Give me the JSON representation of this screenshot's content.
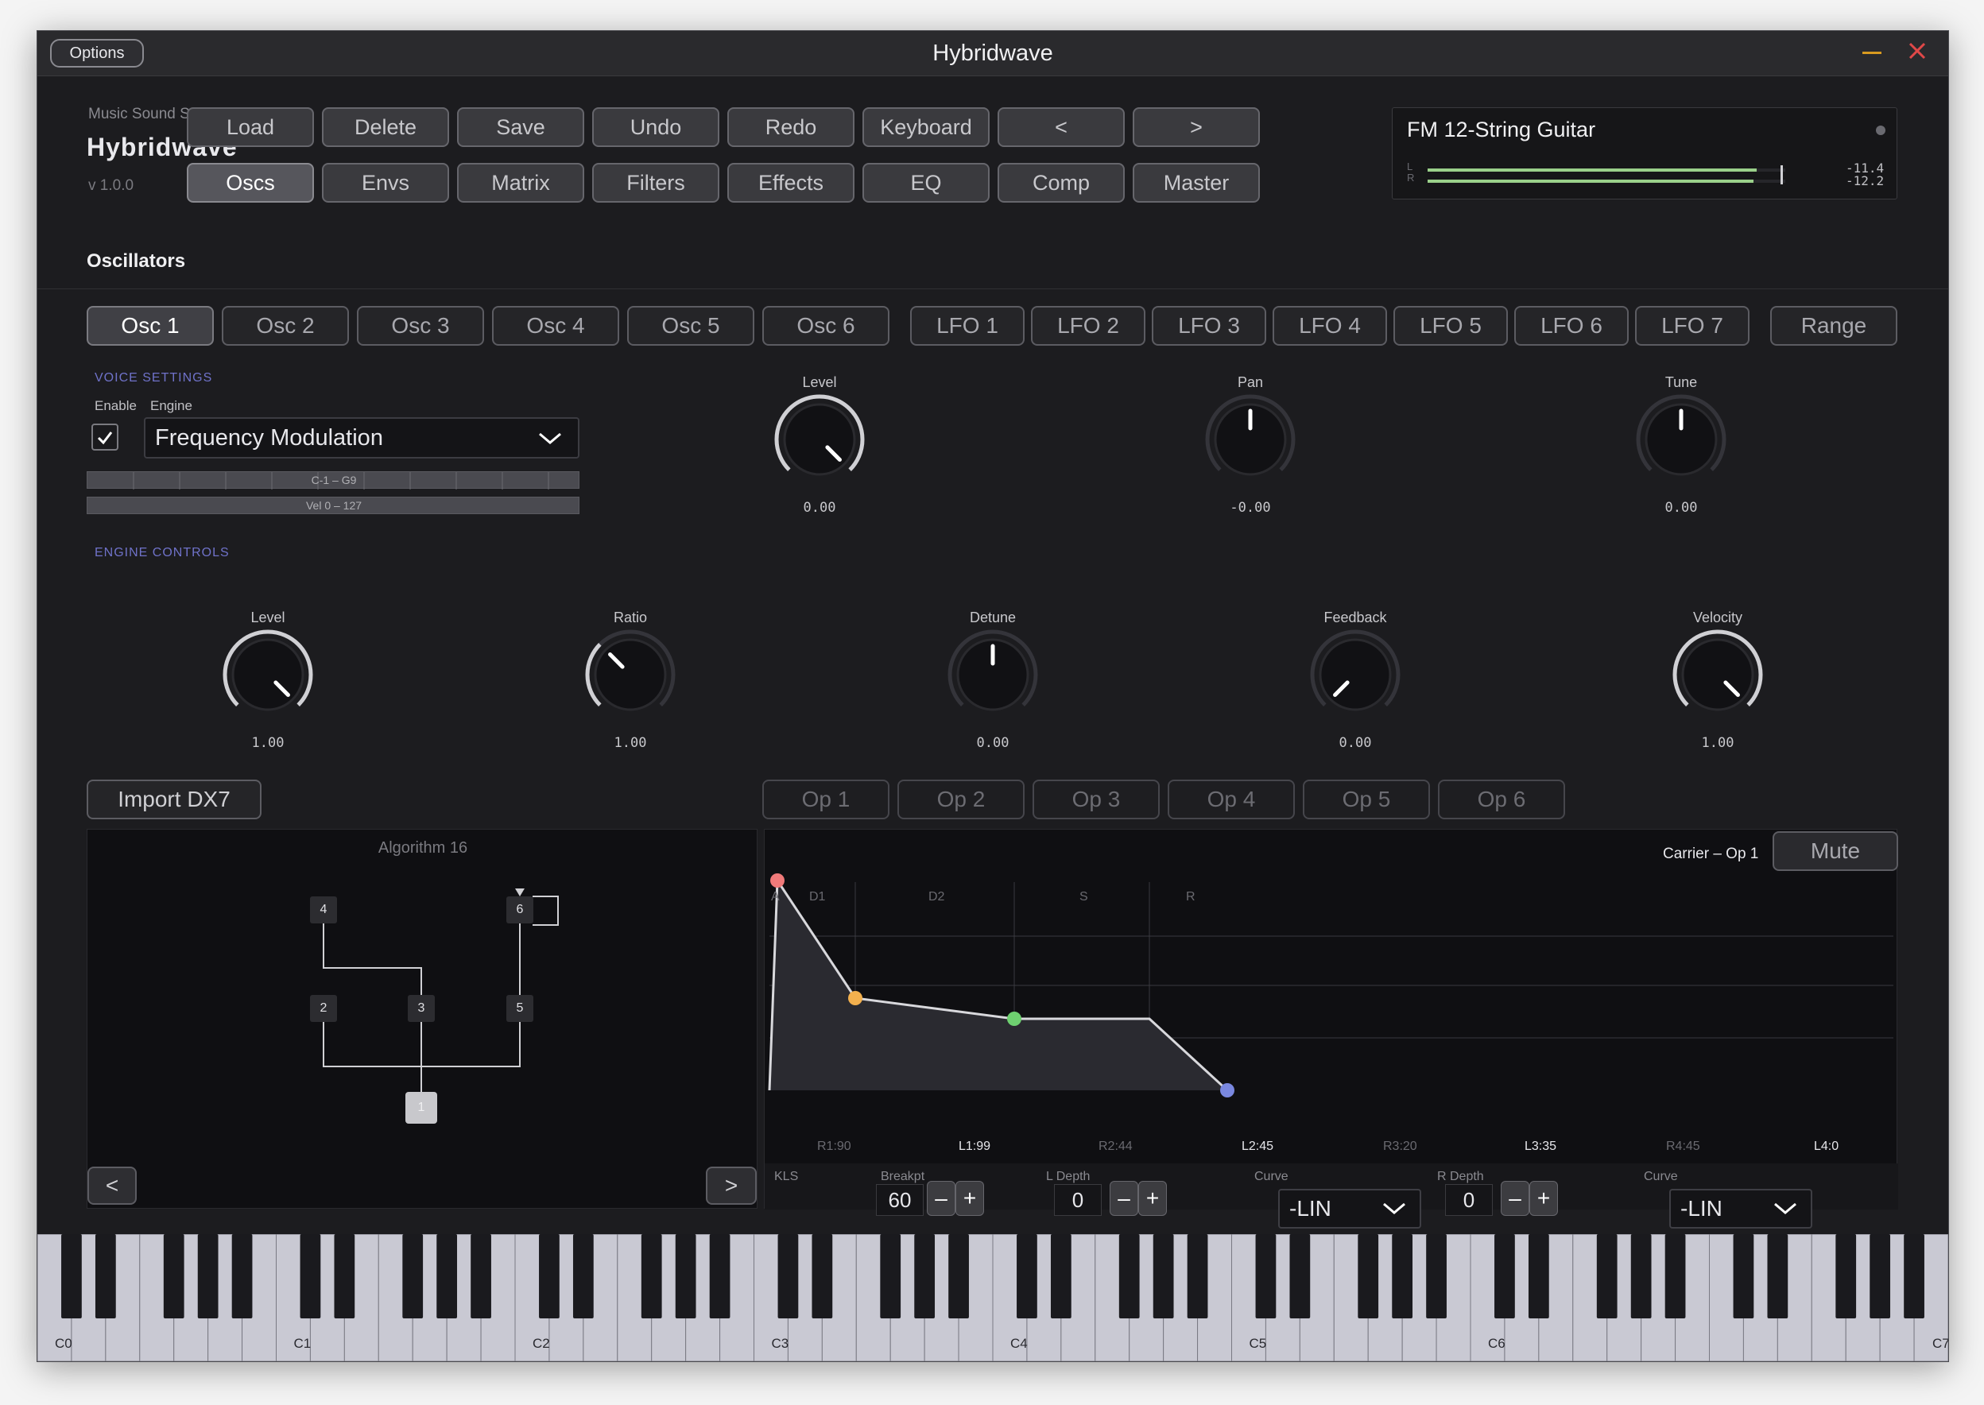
{
  "window": {
    "title": "Hybridwave",
    "options_label": "Options"
  },
  "brand": {
    "company": "Music Sound Software",
    "product": "Hybridwave",
    "version": "v 1.0.0"
  },
  "toolbar": {
    "row1": [
      "Load",
      "Delete",
      "Save",
      "Undo",
      "Redo",
      "Keyboard",
      "<",
      ">"
    ],
    "row2": [
      "Oscs",
      "Envs",
      "Matrix",
      "Filters",
      "Effects",
      "EQ",
      "Comp",
      "Master"
    ],
    "row2_selected": "Oscs"
  },
  "preset": {
    "name": "FM 12-String Guitar",
    "meter_l_label": "L",
    "meter_r_label": "R",
    "meter_l_value": "-11.4",
    "meter_r_value": "-12.2",
    "meter_l_fill": 0.92,
    "meter_r_fill": 0.91
  },
  "section_title": "Oscillators",
  "osc_tabs": [
    "Osc 1",
    "Osc 2",
    "Osc 3",
    "Osc 4",
    "Osc 5",
    "Osc 6"
  ],
  "lfo_tabs": [
    "LFO 1",
    "LFO 2",
    "LFO 3",
    "LFO 4",
    "LFO 5",
    "LFO 6",
    "LFO 7"
  ],
  "range_label": "Range",
  "selected_osc": "Osc 1",
  "voice": {
    "heading": "VOICE SETTINGS",
    "enable_label": "Enable",
    "engine_label": "Engine",
    "enabled": true,
    "engine": "Frequency Modulation",
    "key_range": "C-1 – G9",
    "vel_range": "Vel 0 – 127"
  },
  "voice_knobs": [
    {
      "label": "Level",
      "value": "0.00"
    },
    {
      "label": "Pan",
      "value": "-0.00"
    },
    {
      "label": "Tune",
      "value": "0.00"
    }
  ],
  "engine_controls": {
    "heading": "ENGINE CONTROLS",
    "knobs": [
      {
        "label": "Level",
        "value": "1.00"
      },
      {
        "label": "Ratio",
        "value": "1.00"
      },
      {
        "label": "Detune",
        "value": "0.00"
      },
      {
        "label": "Feedback",
        "value": "0.00"
      },
      {
        "label": "Velocity",
        "value": "1.00"
      }
    ]
  },
  "import_label": "Import DX7",
  "op_tabs": [
    "Op 1",
    "Op 2",
    "Op 3",
    "Op 4",
    "Op 5",
    "Op 6"
  ],
  "algorithm": {
    "title": "Algorithm 16",
    "ops": [
      "1",
      "2",
      "3",
      "4",
      "5",
      "6"
    ],
    "prev": "<",
    "next": ">"
  },
  "envelope": {
    "carrier_label": "Carrier – Op 1",
    "mute_label": "Mute",
    "stage_labels": [
      "A",
      "D1",
      "D2",
      "S",
      "R"
    ],
    "rates": [
      "R1:90",
      "R2:44",
      "R3:20",
      "R4:45"
    ],
    "levels": [
      "L1:99",
      "L2:45",
      "L3:35",
      "L4:0"
    ]
  },
  "kls": {
    "label": "KLS",
    "breakpt_label": "Breakpt",
    "breakpt": "60",
    "l_depth_label": "L  Depth",
    "l_depth": "0",
    "l_curve_label": "Curve",
    "l_curve": "-LIN",
    "r_depth_label": "R  Depth",
    "r_depth": "0",
    "r_curve_label": "Curve",
    "r_curve": "-LIN",
    "minus": "–",
    "plus": "+"
  },
  "keyboard": {
    "octave_labels": [
      "C0",
      "C1",
      "C2",
      "C3",
      "C4",
      "C5",
      "C6",
      "C7"
    ]
  },
  "colors": {
    "accent": "#6f72c9",
    "attack_point": "#f07a7a",
    "decay1_point": "#f2b04e",
    "decay2_point": "#6ed070",
    "release_point": "#7a88e0",
    "close": "#e04848",
    "minimize": "#e0a020"
  }
}
